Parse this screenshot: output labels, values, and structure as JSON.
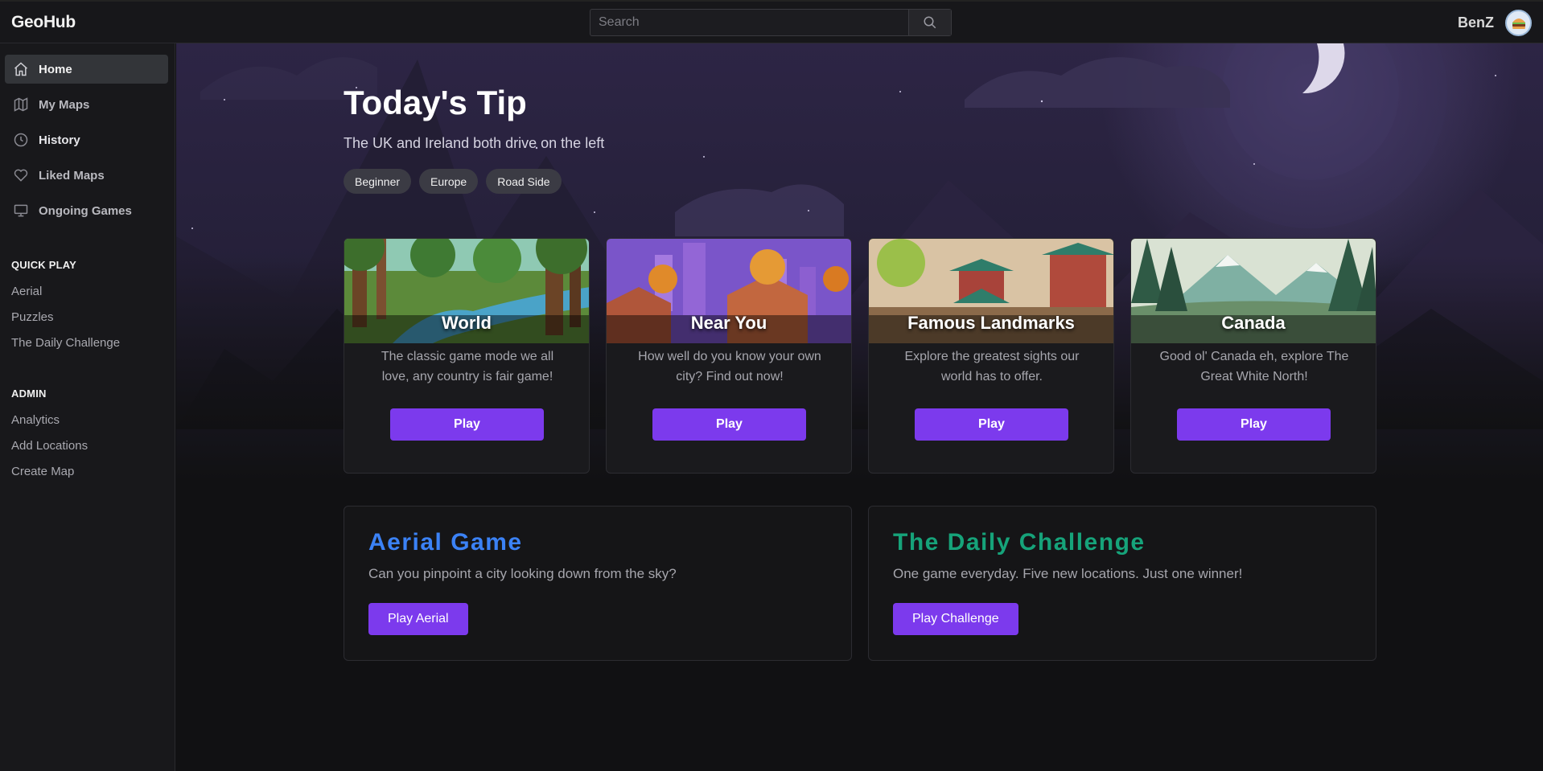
{
  "app": {
    "logo": "GeoHub"
  },
  "search": {
    "placeholder": "Search",
    "value": ""
  },
  "user": {
    "name": "BenZ",
    "avatar_icon": "burger-avatar-icon"
  },
  "sidebar": {
    "nav": [
      {
        "label": "Home",
        "icon": "home-icon",
        "active": true
      },
      {
        "label": "My Maps",
        "icon": "map-icon"
      },
      {
        "label": "History",
        "icon": "clock-icon"
      },
      {
        "label": "Liked Maps",
        "icon": "heart-icon"
      },
      {
        "label": "Ongoing Games",
        "icon": "monitor-icon"
      }
    ],
    "quick_play": {
      "title": "QUICK PLAY",
      "links": [
        "Aerial",
        "Puzzles",
        "The Daily Challenge"
      ]
    },
    "admin": {
      "title": "ADMIN",
      "links": [
        "Analytics",
        "Add Locations",
        "Create Map"
      ]
    }
  },
  "tip": {
    "title": "Today's Tip",
    "text": "The UK and Ireland both drive on the left",
    "tags": [
      "Beginner",
      "Europe",
      "Road Side"
    ]
  },
  "cards": [
    {
      "title": "World",
      "description": "The classic game mode we all love, any country is fair game!",
      "button": "Play"
    },
    {
      "title": "Near You",
      "description": "How well do you know your own city? Find out now!",
      "button": "Play"
    },
    {
      "title": "Famous Landmarks",
      "description": "Explore the greatest sights our world has to offer.",
      "button": "Play"
    },
    {
      "title": "Canada",
      "description": "Good ol' Canada eh, explore The Great White North!",
      "button": "Play"
    }
  ],
  "promos": [
    {
      "title": "Aerial Game",
      "text": "Can you pinpoint a city looking down from the sky?",
      "button": "Play Aerial",
      "color": "#3b82f6"
    },
    {
      "title": "The Daily Challenge",
      "text": "One game everyday. Five new locations. Just one winner!",
      "button": "Play Challenge",
      "color": "#16a37a"
    }
  ],
  "colors": {
    "accent": "#7c3aed",
    "background": "#111113",
    "sidebar": "#18181b"
  }
}
